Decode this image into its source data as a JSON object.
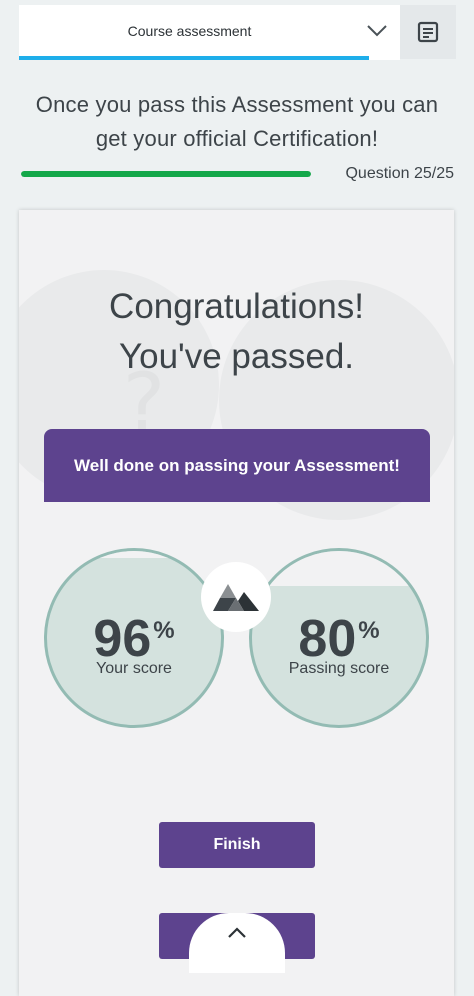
{
  "topbar": {
    "title": "Course assessment"
  },
  "headline": {
    "line1": "Once you pass this Assessment you can",
    "line2": "get your official Certification!"
  },
  "progress": {
    "question_label": "Question 25/25",
    "fraction": 1.0,
    "color": "#14a84a"
  },
  "result": {
    "heading_line1": "Congratulations!",
    "heading_line2": "You've passed.",
    "banner": "Well done on passing your Assessment!",
    "your_score": {
      "value": "96",
      "unit": "%",
      "label": "Your score",
      "fill_fraction": 0.96
    },
    "passing_score": {
      "value": "80",
      "unit": "%",
      "label": "Passing score",
      "fill_fraction": 0.8
    },
    "finish_label": "Finish"
  },
  "colors": {
    "accent": "#5d438e",
    "tab_underline": "#1eaeea",
    "score_ring": "#93bbb3",
    "score_fill": "#d4e2de"
  },
  "icons": [
    "chevron-down-icon",
    "notes-icon",
    "brand-logo-icon",
    "chevron-up-icon"
  ]
}
